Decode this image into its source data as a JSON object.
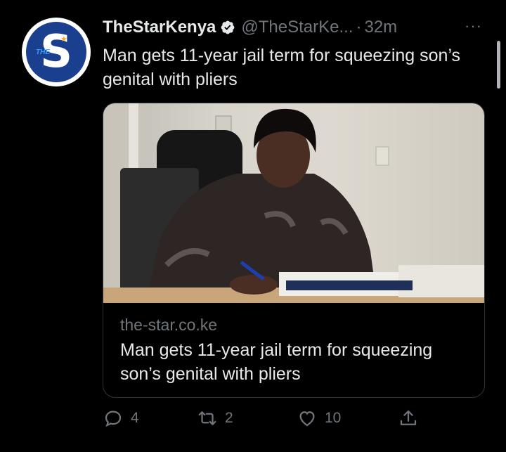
{
  "tweet": {
    "display_name": "TheStarKenya",
    "handle": "@TheStarKe...",
    "separator": "·",
    "time": "32m",
    "more": "···",
    "text": "Man gets 11-year jail term for squeezing son’s genital with pliers",
    "avatar": {
      "letter": "S",
      "tag": "THE"
    }
  },
  "card": {
    "domain": "the-star.co.ke",
    "title": "Man gets 11-year jail term for squeezing son’s genital with pliers"
  },
  "actions": {
    "reply_count": "4",
    "retweet_count": "2",
    "like_count": "10"
  },
  "icons": {
    "verified": "verified-badge-icon",
    "reply": "reply-icon",
    "retweet": "retweet-icon",
    "like": "heart-icon",
    "share": "share-icon",
    "more": "more-icon"
  },
  "colors": {
    "background": "#000000",
    "text": "#e7e9ea",
    "muted": "#71767b",
    "border": "#2f3336",
    "avatar_blue": "#1b3f8f"
  }
}
